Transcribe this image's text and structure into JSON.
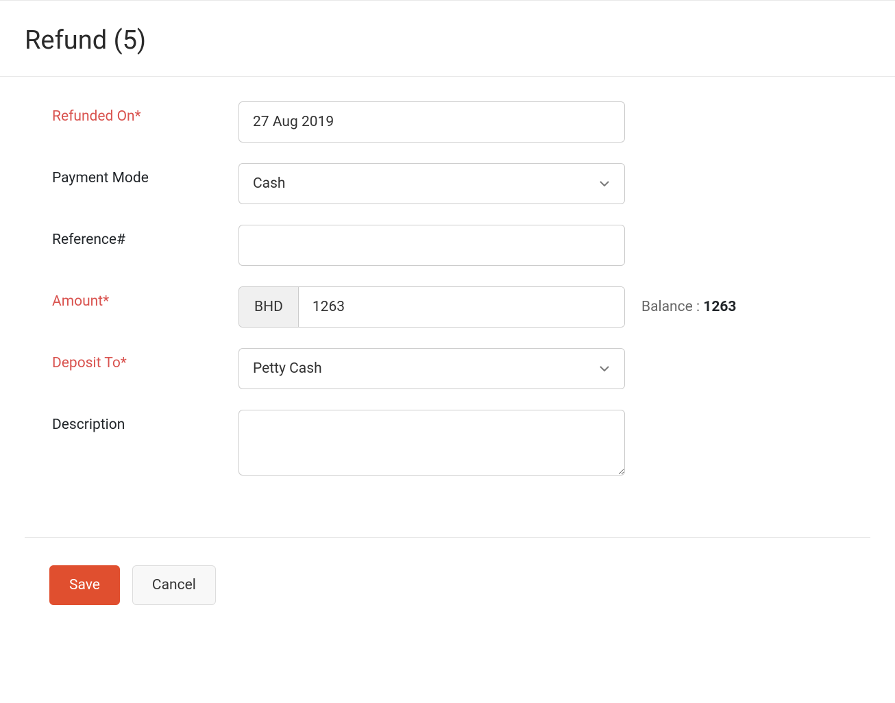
{
  "page": {
    "title": "Refund (5)"
  },
  "form": {
    "refunded_on": {
      "label": "Refunded On*",
      "value": "27 Aug 2019"
    },
    "payment_mode": {
      "label": "Payment Mode",
      "value": "Cash"
    },
    "reference": {
      "label": "Reference#",
      "value": ""
    },
    "amount": {
      "label": "Amount*",
      "currency": "BHD",
      "value": "1263"
    },
    "balance": {
      "label": "Balance : ",
      "value": "1263"
    },
    "deposit_to": {
      "label": "Deposit To*",
      "value": "Petty Cash"
    },
    "description": {
      "label": "Description",
      "value": ""
    }
  },
  "buttons": {
    "save": "Save",
    "cancel": "Cancel"
  }
}
